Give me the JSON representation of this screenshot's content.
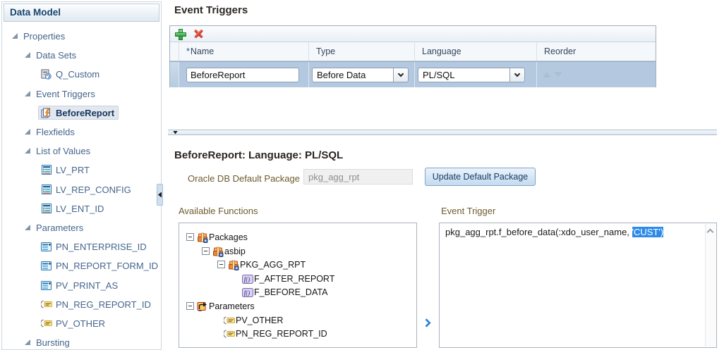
{
  "colors": {
    "selection_highlight": "#2d8be8",
    "accent_blue": "#2f86dc",
    "label_brown": "#6e5b2e",
    "selected_row_bg": "#b4c9df"
  },
  "sidebar": {
    "title": "Data Model",
    "tree": [
      {
        "label": "Properties",
        "level": 1,
        "group": true
      },
      {
        "label": "Data Sets",
        "level": 2,
        "group": true
      },
      {
        "label": "Q_Custom",
        "level": 3,
        "icon": "dataset"
      },
      {
        "label": "Event Triggers",
        "level": 2,
        "group": true
      },
      {
        "label": "BeforeReport",
        "level": 3,
        "icon": "event-trigger",
        "selected": true
      },
      {
        "label": "Flexfields",
        "level": 2,
        "group": true
      },
      {
        "label": "List of Values",
        "level": 2,
        "group": true
      },
      {
        "label": "LV_PRT",
        "level": 3,
        "icon": "list-of-values"
      },
      {
        "label": "LV_REP_CONFIG",
        "level": 3,
        "icon": "list-of-values"
      },
      {
        "label": "LV_ENT_ID",
        "level": 3,
        "icon": "list-of-values"
      },
      {
        "label": "Parameters",
        "level": 2,
        "group": true
      },
      {
        "label": "PN_ENTERPRISE_ID",
        "level": 3,
        "icon": "parameter-menu"
      },
      {
        "label": "PN_REPORT_FORM_ID",
        "level": 3,
        "icon": "parameter-menu"
      },
      {
        "label": "PV_PRINT_AS",
        "level": 3,
        "icon": "parameter-menu"
      },
      {
        "label": "PN_REG_REPORT_ID",
        "level": 3,
        "icon": "parameter-text"
      },
      {
        "label": "PV_OTHER",
        "level": 3,
        "icon": "parameter-text"
      },
      {
        "label": "Bursting",
        "level": 2,
        "group": true
      }
    ]
  },
  "event_triggers": {
    "heading": "Event Triggers",
    "required_marker": "*",
    "columns": {
      "name": "Name",
      "type": "Type",
      "language": "Language",
      "reorder": "Reorder"
    },
    "row": {
      "name_value": "BeforeReport",
      "type_value": "Before Data",
      "language_value": "PL/SQL"
    }
  },
  "detail": {
    "heading": "BeforeReport: Language: PL/SQL",
    "package_label": "Oracle DB Default Package",
    "package_value": "pkg_agg_rpt",
    "update_button_label": "Update Default Package",
    "available_functions_label": "Available Functions",
    "event_trigger_label": "Event Trigger",
    "code_before_selection": "pkg_agg_rpt.f_before_data(:xdo_user_name, ",
    "code_selected": "'CUST')",
    "functions_tree": [
      {
        "label": "Packages",
        "level": 1,
        "expand": true,
        "icon": "package"
      },
      {
        "label": "asbip",
        "level": 2,
        "expand": true,
        "icon": "package"
      },
      {
        "label": "PKG_AGG_RPT",
        "level": 3,
        "expand": true,
        "icon": "package"
      },
      {
        "label": "F_AFTER_REPORT",
        "level": 4,
        "icon": "function"
      },
      {
        "label": "F_BEFORE_DATA",
        "level": 4,
        "icon": "function"
      },
      {
        "label": "Parameters",
        "level": 1,
        "expand": true,
        "icon": "parameters-folder"
      },
      {
        "label": "PV_OTHER",
        "level": 2,
        "icon": "parameter-text"
      },
      {
        "label": "PN_REG_REPORT_ID",
        "level": 2,
        "icon": "parameter-text"
      }
    ]
  }
}
